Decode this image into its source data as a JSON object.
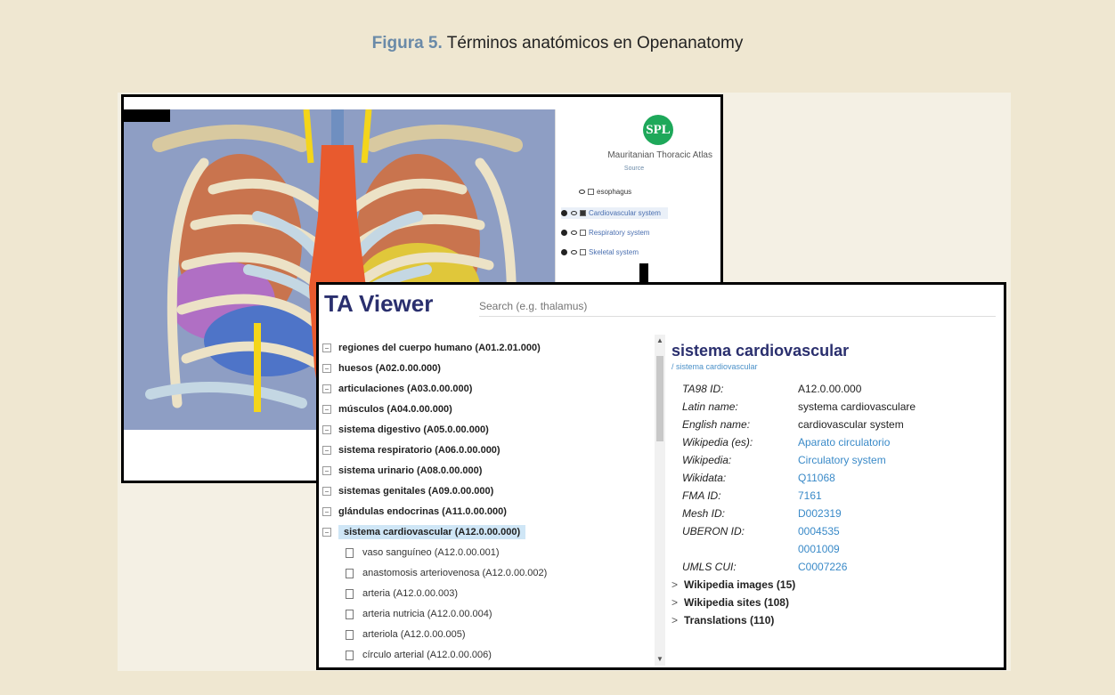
{
  "caption": {
    "figure": "Figura 5.",
    "title": "Términos anatómicos en Openanatomy"
  },
  "atlas": {
    "logo": "SPL",
    "title": "Mauritanian Thoracic Atlas",
    "source": "Source",
    "layers": [
      {
        "label": "esophagus",
        "checked": false,
        "expandable": false
      },
      {
        "label": "Cardiovascular system",
        "checked": true,
        "expandable": true
      },
      {
        "label": "Respiratory system",
        "checked": false,
        "expandable": true
      },
      {
        "label": "Skeletal system",
        "checked": false,
        "expandable": true
      }
    ]
  },
  "ta_viewer": {
    "title": "TA Viewer",
    "search_placeholder": "Search (e.g. thalamus)",
    "tree": [
      "regiones del cuerpo humano (A01.2.01.000)",
      "huesos (A02.0.00.000)",
      "articulaciones (A03.0.00.000)",
      "músculos (A04.0.00.000)",
      "sistema digestivo (A05.0.00.000)",
      "sistema respiratorio (A06.0.00.000)",
      "sistema urinario (A08.0.00.000)",
      "sistemas genitales (A09.0.00.000)",
      "glándulas endocrinas (A11.0.00.000)",
      "sistema cardiovascular (A12.0.00.000)"
    ],
    "children": [
      "vaso sanguíneo (A12.0.00.001)",
      "anastomosis arteriovenosa (A12.0.00.002)",
      "arteria (A12.0.00.003)",
      "arteria nutricia (A12.0.00.004)",
      "arteriola (A12.0.00.005)",
      "círculo arterial (A12.0.00.006)"
    ],
    "detail": {
      "heading": "sistema cardiovascular",
      "breadcrumb": "/ sistema cardiovascular",
      "props": [
        {
          "k": "TA98 ID:",
          "v": "A12.0.00.000",
          "link": false
        },
        {
          "k": "Latin name:",
          "v": "systema cardiovasculare",
          "link": false
        },
        {
          "k": "English name:",
          "v": "cardiovascular system",
          "link": false
        },
        {
          "k": "Wikipedia (es):",
          "v": "Aparato circulatorio",
          "link": true
        },
        {
          "k": "Wikipedia:",
          "v": "Circulatory system",
          "link": true
        },
        {
          "k": "Wikidata:",
          "v": "Q11068",
          "link": true
        },
        {
          "k": "FMA ID:",
          "v": "7161",
          "link": true
        },
        {
          "k": "Mesh ID:",
          "v": "D002319",
          "link": true
        },
        {
          "k": "UBERON ID:",
          "v": "0004535",
          "link": true
        },
        {
          "k": "",
          "v": "0001009",
          "link": true
        },
        {
          "k": "UMLS CUI:",
          "v": "C0007226",
          "link": true
        }
      ],
      "expanders": [
        "Wikipedia images (15)",
        "Wikipedia sites (108)",
        "Translations (110)"
      ]
    }
  }
}
